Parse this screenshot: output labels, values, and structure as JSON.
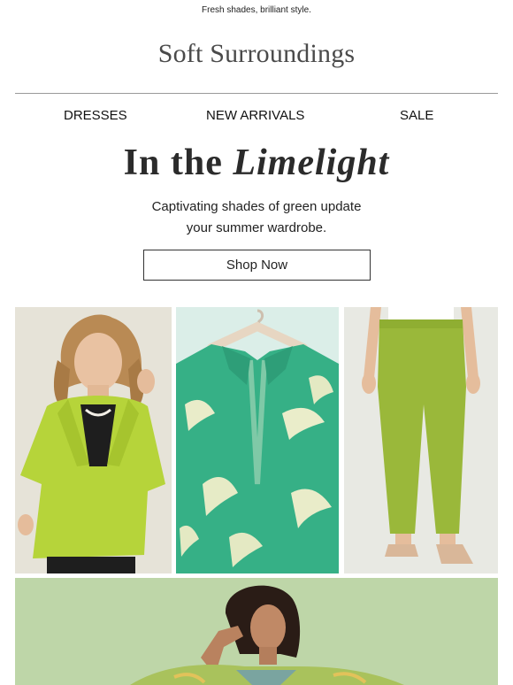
{
  "preheader": "Fresh shades, brilliant style.",
  "brand": {
    "logo_text": "Soft Surroundings"
  },
  "nav": {
    "items": [
      "DRESSES",
      "NEW ARRIVALS",
      "SALE"
    ]
  },
  "hero": {
    "headline_prefix": "In the",
    "headline_emphasis": "Limelight",
    "subcopy_line1": "Captivating shades of green update",
    "subcopy_line2": "your summer wardrobe.",
    "cta_label": "Shop Now"
  },
  "photos": [
    {
      "subject": "model-lime-jacket-photo"
    },
    {
      "subject": "green-printed-blouse-on-hanger-photo"
    },
    {
      "subject": "green-pants-legs-photo"
    },
    {
      "subject": "model-green-print-top-photo"
    }
  ],
  "colors": {
    "lime": "#b5d33a",
    "mint": "#35b185",
    "olive_green": "#99b63a",
    "sage": "#bcd6a6",
    "text": "#1a1a1a",
    "rule": "#9a9a9a"
  }
}
